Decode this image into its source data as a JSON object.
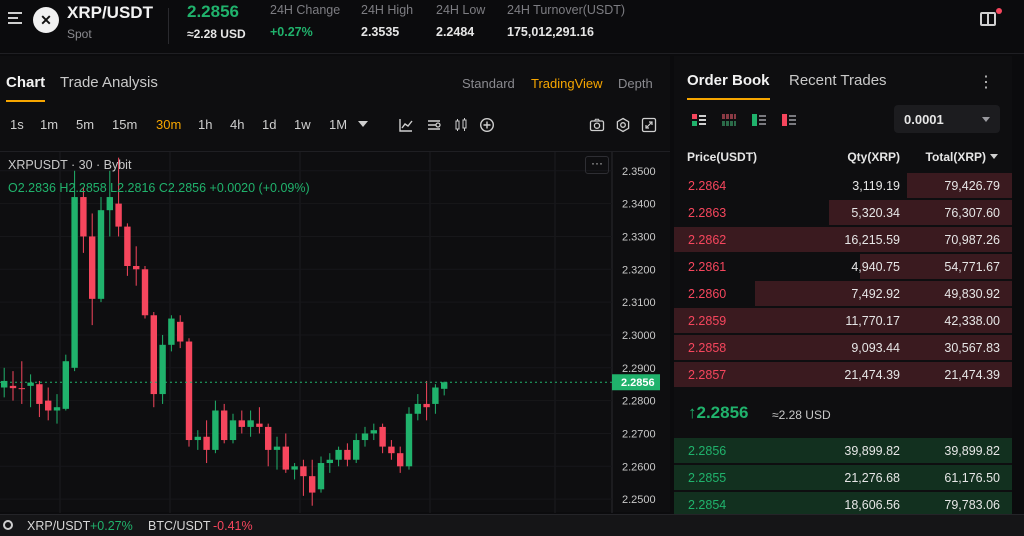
{
  "header": {
    "pair": "XRP/USDT",
    "market_type": "Spot",
    "coin_icon": "xrp-logo-icon",
    "last_price": "2.2856",
    "last_price_usd": "≈2.28 USD",
    "stats": [
      {
        "label": "24H Change",
        "value": "+0.27%",
        "color": "#20b26c"
      },
      {
        "label": "24H High",
        "value": "2.3535"
      },
      {
        "label": "24H Low",
        "value": "2.2484"
      },
      {
        "label": "24H Turnover(USDT)",
        "value": "175,012,291.16"
      }
    ]
  },
  "left": {
    "tabs": [
      "Chart",
      "Trade Analysis"
    ],
    "views": [
      "Standard",
      "TradingView",
      "Depth"
    ],
    "timeframes": [
      "1s",
      "1m",
      "5m",
      "15m",
      "30m",
      "1h",
      "4h",
      "1d",
      "1w",
      "1M"
    ],
    "selected_timeframe": "30m",
    "legend_symbol": "XRPUSDT · 30 · Bybit",
    "legend_ohlc": "O2.2836  H2.2858  L2.2816  C2.2856  +0.0020 (+0.09%)",
    "price_axis": [
      "2.3500",
      "2.3400",
      "2.3300",
      "2.3200",
      "2.3100",
      "2.3000",
      "2.2900",
      "2.2800",
      "2.2700",
      "2.2600",
      "2.2500"
    ],
    "current_price_tag": "2.2856"
  },
  "chart_data": {
    "type": "candlestick",
    "symbol": "XRPUSDT",
    "interval": "30",
    "exchange": "Bybit",
    "ylim": [
      2.247,
      2.3545
    ],
    "candles": [
      {
        "o": 2.284,
        "h": 2.29,
        "l": 2.281,
        "c": 2.286
      },
      {
        "o": 2.2845,
        "h": 2.289,
        "l": 2.28,
        "c": 2.2838
      },
      {
        "o": 2.2838,
        "h": 2.292,
        "l": 2.279,
        "c": 2.2835
      },
      {
        "o": 2.2845,
        "h": 2.288,
        "l": 2.278,
        "c": 2.2855
      },
      {
        "o": 2.285,
        "h": 2.286,
        "l": 2.275,
        "c": 2.279
      },
      {
        "o": 2.28,
        "h": 2.284,
        "l": 2.274,
        "c": 2.277
      },
      {
        "o": 2.277,
        "h": 2.282,
        "l": 2.273,
        "c": 2.278
      },
      {
        "o": 2.2775,
        "h": 2.294,
        "l": 2.277,
        "c": 2.292
      },
      {
        "o": 2.29,
        "h": 2.35,
        "l": 2.289,
        "c": 2.342
      },
      {
        "o": 2.342,
        "h": 2.345,
        "l": 2.325,
        "c": 2.33
      },
      {
        "o": 2.33,
        "h": 2.337,
        "l": 2.303,
        "c": 2.311
      },
      {
        "o": 2.311,
        "h": 2.342,
        "l": 2.31,
        "c": 2.338
      },
      {
        "o": 2.338,
        "h": 2.35,
        "l": 2.33,
        "c": 2.342
      },
      {
        "o": 2.34,
        "h": 2.354,
        "l": 2.33,
        "c": 2.333
      },
      {
        "o": 2.333,
        "h": 2.334,
        "l": 2.318,
        "c": 2.321
      },
      {
        "o": 2.321,
        "h": 2.327,
        "l": 2.315,
        "c": 2.32
      },
      {
        "o": 2.32,
        "h": 2.321,
        "l": 2.305,
        "c": 2.306
      },
      {
        "o": 2.306,
        "h": 2.307,
        "l": 2.278,
        "c": 2.282
      },
      {
        "o": 2.282,
        "h": 2.3,
        "l": 2.279,
        "c": 2.297
      },
      {
        "o": 2.297,
        "h": 2.306,
        "l": 2.295,
        "c": 2.305
      },
      {
        "o": 2.304,
        "h": 2.306,
        "l": 2.296,
        "c": 2.298
      },
      {
        "o": 2.298,
        "h": 2.299,
        "l": 2.266,
        "c": 2.268
      },
      {
        "o": 2.268,
        "h": 2.271,
        "l": 2.265,
        "c": 2.269
      },
      {
        "o": 2.269,
        "h": 2.274,
        "l": 2.261,
        "c": 2.265
      },
      {
        "o": 2.265,
        "h": 2.28,
        "l": 2.264,
        "c": 2.277
      },
      {
        "o": 2.277,
        "h": 2.279,
        "l": 2.267,
        "c": 2.268
      },
      {
        "o": 2.268,
        "h": 2.276,
        "l": 2.267,
        "c": 2.274
      },
      {
        "o": 2.274,
        "h": 2.277,
        "l": 2.27,
        "c": 2.272
      },
      {
        "o": 2.272,
        "h": 2.277,
        "l": 2.269,
        "c": 2.274
      },
      {
        "o": 2.273,
        "h": 2.278,
        "l": 2.27,
        "c": 2.272
      },
      {
        "o": 2.272,
        "h": 2.273,
        "l": 2.26,
        "c": 2.265
      },
      {
        "o": 2.265,
        "h": 2.269,
        "l": 2.259,
        "c": 2.266
      },
      {
        "o": 2.266,
        "h": 2.27,
        "l": 2.258,
        "c": 2.259
      },
      {
        "o": 2.259,
        "h": 2.261,
        "l": 2.256,
        "c": 2.26
      },
      {
        "o": 2.26,
        "h": 2.262,
        "l": 2.251,
        "c": 2.257
      },
      {
        "o": 2.257,
        "h": 2.262,
        "l": 2.248,
        "c": 2.252
      },
      {
        "o": 2.253,
        "h": 2.263,
        "l": 2.252,
        "c": 2.261
      },
      {
        "o": 2.261,
        "h": 2.264,
        "l": 2.258,
        "c": 2.262
      },
      {
        "o": 2.262,
        "h": 2.266,
        "l": 2.26,
        "c": 2.265
      },
      {
        "o": 2.265,
        "h": 2.267,
        "l": 2.26,
        "c": 2.262
      },
      {
        "o": 2.262,
        "h": 2.27,
        "l": 2.261,
        "c": 2.268
      },
      {
        "o": 2.268,
        "h": 2.272,
        "l": 2.266,
        "c": 2.27
      },
      {
        "o": 2.27,
        "h": 2.273,
        "l": 2.268,
        "c": 2.271
      },
      {
        "o": 2.272,
        "h": 2.273,
        "l": 2.264,
        "c": 2.266
      },
      {
        "o": 2.266,
        "h": 2.268,
        "l": 2.262,
        "c": 2.264
      },
      {
        "o": 2.264,
        "h": 2.266,
        "l": 2.258,
        "c": 2.26
      },
      {
        "o": 2.26,
        "h": 2.278,
        "l": 2.259,
        "c": 2.276
      },
      {
        "o": 2.276,
        "h": 2.282,
        "l": 2.274,
        "c": 2.279
      },
      {
        "o": 2.279,
        "h": 2.286,
        "l": 2.274,
        "c": 2.278
      },
      {
        "o": 2.279,
        "h": 2.285,
        "l": 2.276,
        "c": 2.284
      },
      {
        "o": 2.2836,
        "h": 2.2858,
        "l": 2.2816,
        "c": 2.2856
      }
    ]
  },
  "orderbook": {
    "tabs": [
      "Order Book",
      "Recent Trades"
    ],
    "precision": "0.0001",
    "headers": {
      "price": "Price(USDT)",
      "qty": "Qty(XRP)",
      "total": "Total(XRP)"
    },
    "asks": [
      {
        "price": "2.2864",
        "qty": "3,119.19",
        "total": "79,426.79",
        "depth": 0.31
      },
      {
        "price": "2.2863",
        "qty": "5,320.34",
        "total": "76,307.60",
        "depth": 0.54
      },
      {
        "price": "2.2862",
        "qty": "16,215.59",
        "total": "70,987.26",
        "depth": 1.0
      },
      {
        "price": "2.2861",
        "qty": "4,940.75",
        "total": "54,771.67",
        "depth": 0.45
      },
      {
        "price": "2.2860",
        "qty": "7,492.92",
        "total": "49,830.92",
        "depth": 0.76
      },
      {
        "price": "2.2859",
        "qty": "11,770.17",
        "total": "42,338.00",
        "depth": 1.0
      },
      {
        "price": "2.2858",
        "qty": "9,093.44",
        "total": "30,567.83",
        "depth": 1.0
      },
      {
        "price": "2.2857",
        "qty": "21,474.39",
        "total": "21,474.39",
        "depth": 1.0
      }
    ],
    "mid_price": "↑2.2856",
    "mid_usd": "≈2.28 USD",
    "bids": [
      {
        "price": "2.2856",
        "qty": "39,899.82",
        "total": "39,899.82",
        "depth": 1.0
      },
      {
        "price": "2.2855",
        "qty": "21,276.68",
        "total": "61,176.50",
        "depth": 1.0
      },
      {
        "price": "2.2854",
        "qty": "18,606.56",
        "total": "79,783.06",
        "depth": 1.0
      }
    ]
  },
  "footer": [
    {
      "pair": "XRP/USDT",
      "change": "+0.27%",
      "color": "#20b26c"
    },
    {
      "pair": "BTC/USDT",
      "change": "-0.41%",
      "color": "#f6465d"
    }
  ]
}
